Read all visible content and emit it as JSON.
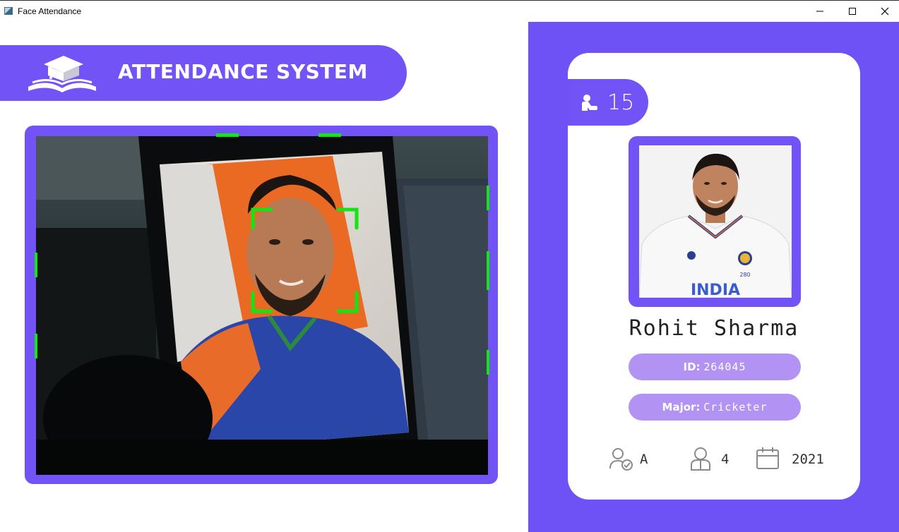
{
  "window": {
    "title": "Face Attendance",
    "minimize_icon": "minimize-icon",
    "maximize_icon": "maximize-icon",
    "close_icon": "close-icon"
  },
  "header": {
    "title": "ATTENDANCE SYSTEM",
    "logo_icon": "graduation-book-icon"
  },
  "camera": {
    "face_box_color": "#14e314",
    "frame_color": "#7254f6"
  },
  "student": {
    "total_attendance": "15",
    "name": "Rohit Sharma",
    "id_label": "ID:",
    "id_value": "264045",
    "major_label": "Major:",
    "major_value": "Cricketer",
    "standing": "A",
    "year": "4",
    "starting_year": "2021"
  },
  "colors": {
    "accent": "#7254f6",
    "pill": "#b293f4",
    "face_box": "#14e314"
  }
}
